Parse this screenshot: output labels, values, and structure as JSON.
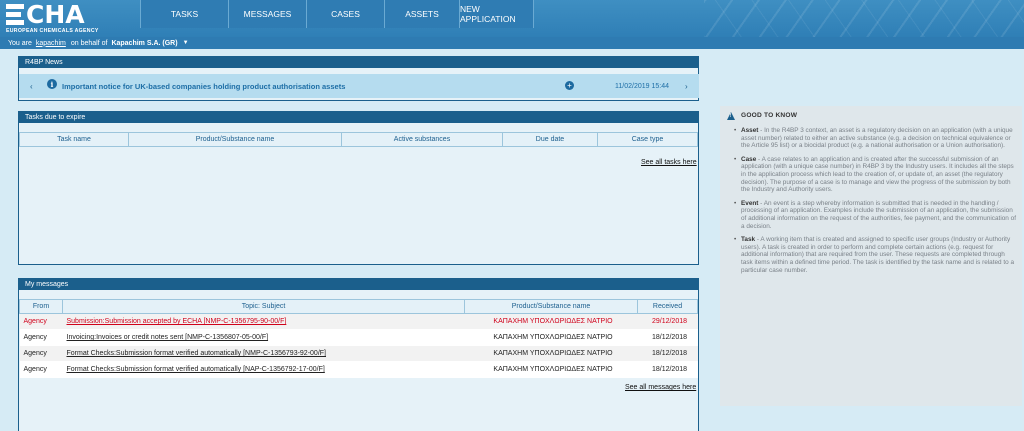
{
  "header": {
    "logo_text": "ECHA",
    "logo_sub": "EUROPEAN CHEMICALS AGENCY",
    "nav": [
      "TASKS",
      "MESSAGES",
      "CASES",
      "ASSETS",
      "NEW APPLICATION"
    ]
  },
  "userbar": {
    "prefix": "You are",
    "user": "kapachim",
    "middle": "on behalf of",
    "org": "Kapachim S.A. (GR)"
  },
  "news": {
    "title": "R4BP News",
    "item_title": "Important notice for UK-based companies holding product authorisation assets",
    "date": "11/02/2019 15:44"
  },
  "tasks": {
    "title": "Tasks due to expire",
    "columns": [
      "Task name",
      "Product/Substance name",
      "Active substances",
      "Due date",
      "Case type"
    ],
    "see_all": "See all tasks here"
  },
  "messages": {
    "title": "My messages",
    "columns": [
      "From",
      "Topic: Subject",
      "Product/Substance name",
      "Received"
    ],
    "rows": [
      {
        "from": "Agency",
        "topic": "Submission:Submission accepted by ECHA [NMP-C-1356795-90-00/F]",
        "product": "ΚΑΠΑΧΗΜ ΥΠΟΧΛΩΡΙΩΔΕΣ ΝΑΤΡΙΟ",
        "received": "29/12/2018",
        "unread": true
      },
      {
        "from": "Agency",
        "topic": "Invoicing:Invoices or credit notes sent [NMP-C-1356807-05-00/F]",
        "product": "ΚΑΠΑΧΗΜ ΥΠΟΧΛΩΡΙΩΔΕΣ ΝΑΤΡΙΟ",
        "received": "18/12/2018",
        "unread": false
      },
      {
        "from": "Agency",
        "topic": "Format Checks:Submission format verified automatically [NMP-C-1356793-92-00/F]",
        "product": "ΚΑΠΑΧΗΜ ΥΠΟΧΛΩΡΙΩΔΕΣ ΝΑΤΡΙΟ",
        "received": "18/12/2018",
        "unread": false
      },
      {
        "from": "Agency",
        "topic": "Format Checks:Submission format verified automatically [NAP-C-1356792-17-00/F]",
        "product": "ΚΑΠΑΧΗΜ ΥΠΟΧΛΩΡΙΩΔΕΣ ΝΑΤΡΙΟ",
        "received": "18/12/2018",
        "unread": false
      }
    ],
    "see_all": "See all messages here"
  },
  "good_to_know": {
    "title": "GOOD TO KNOW",
    "items": [
      {
        "term": "Asset",
        "text": " - In the R4BP 3 context, an asset is a regulatory decision on an application (with a unique asset number) related to either an active substance (e.g. a decision on technical equivalence or the Article 95 list) or a biocidal product (e.g. a national authorisation or a Union authorisation)."
      },
      {
        "term": "Case",
        "text": " - A case relates to an application and is created after the successful submission of an application (with a unique case number) in R4BP 3 by the Industry users. It includes all the steps in the application process which lead to the creation of, or update of, an asset (the regulatory decision). The purpose of a case is to manage and view the progress of the submission by both the Industry and Authority users."
      },
      {
        "term": "Event",
        "text": " - An event is a step whereby information is submitted that is needed in the handling / processing of an application. Examples include the submission of an application, the submission of additional information on the request of the authorities, fee payment, and the communication of a decision."
      },
      {
        "term": "Task",
        "text": " - A working item that is created and assigned to specific user groups (Industry or Authority users). A task is created in order to perform and complete certain actions (e.g. request for additional information) that are required from the user. These requests are completed through task items within a defined time period. The task is identified by the task name and is related to a particular case number."
      }
    ]
  }
}
